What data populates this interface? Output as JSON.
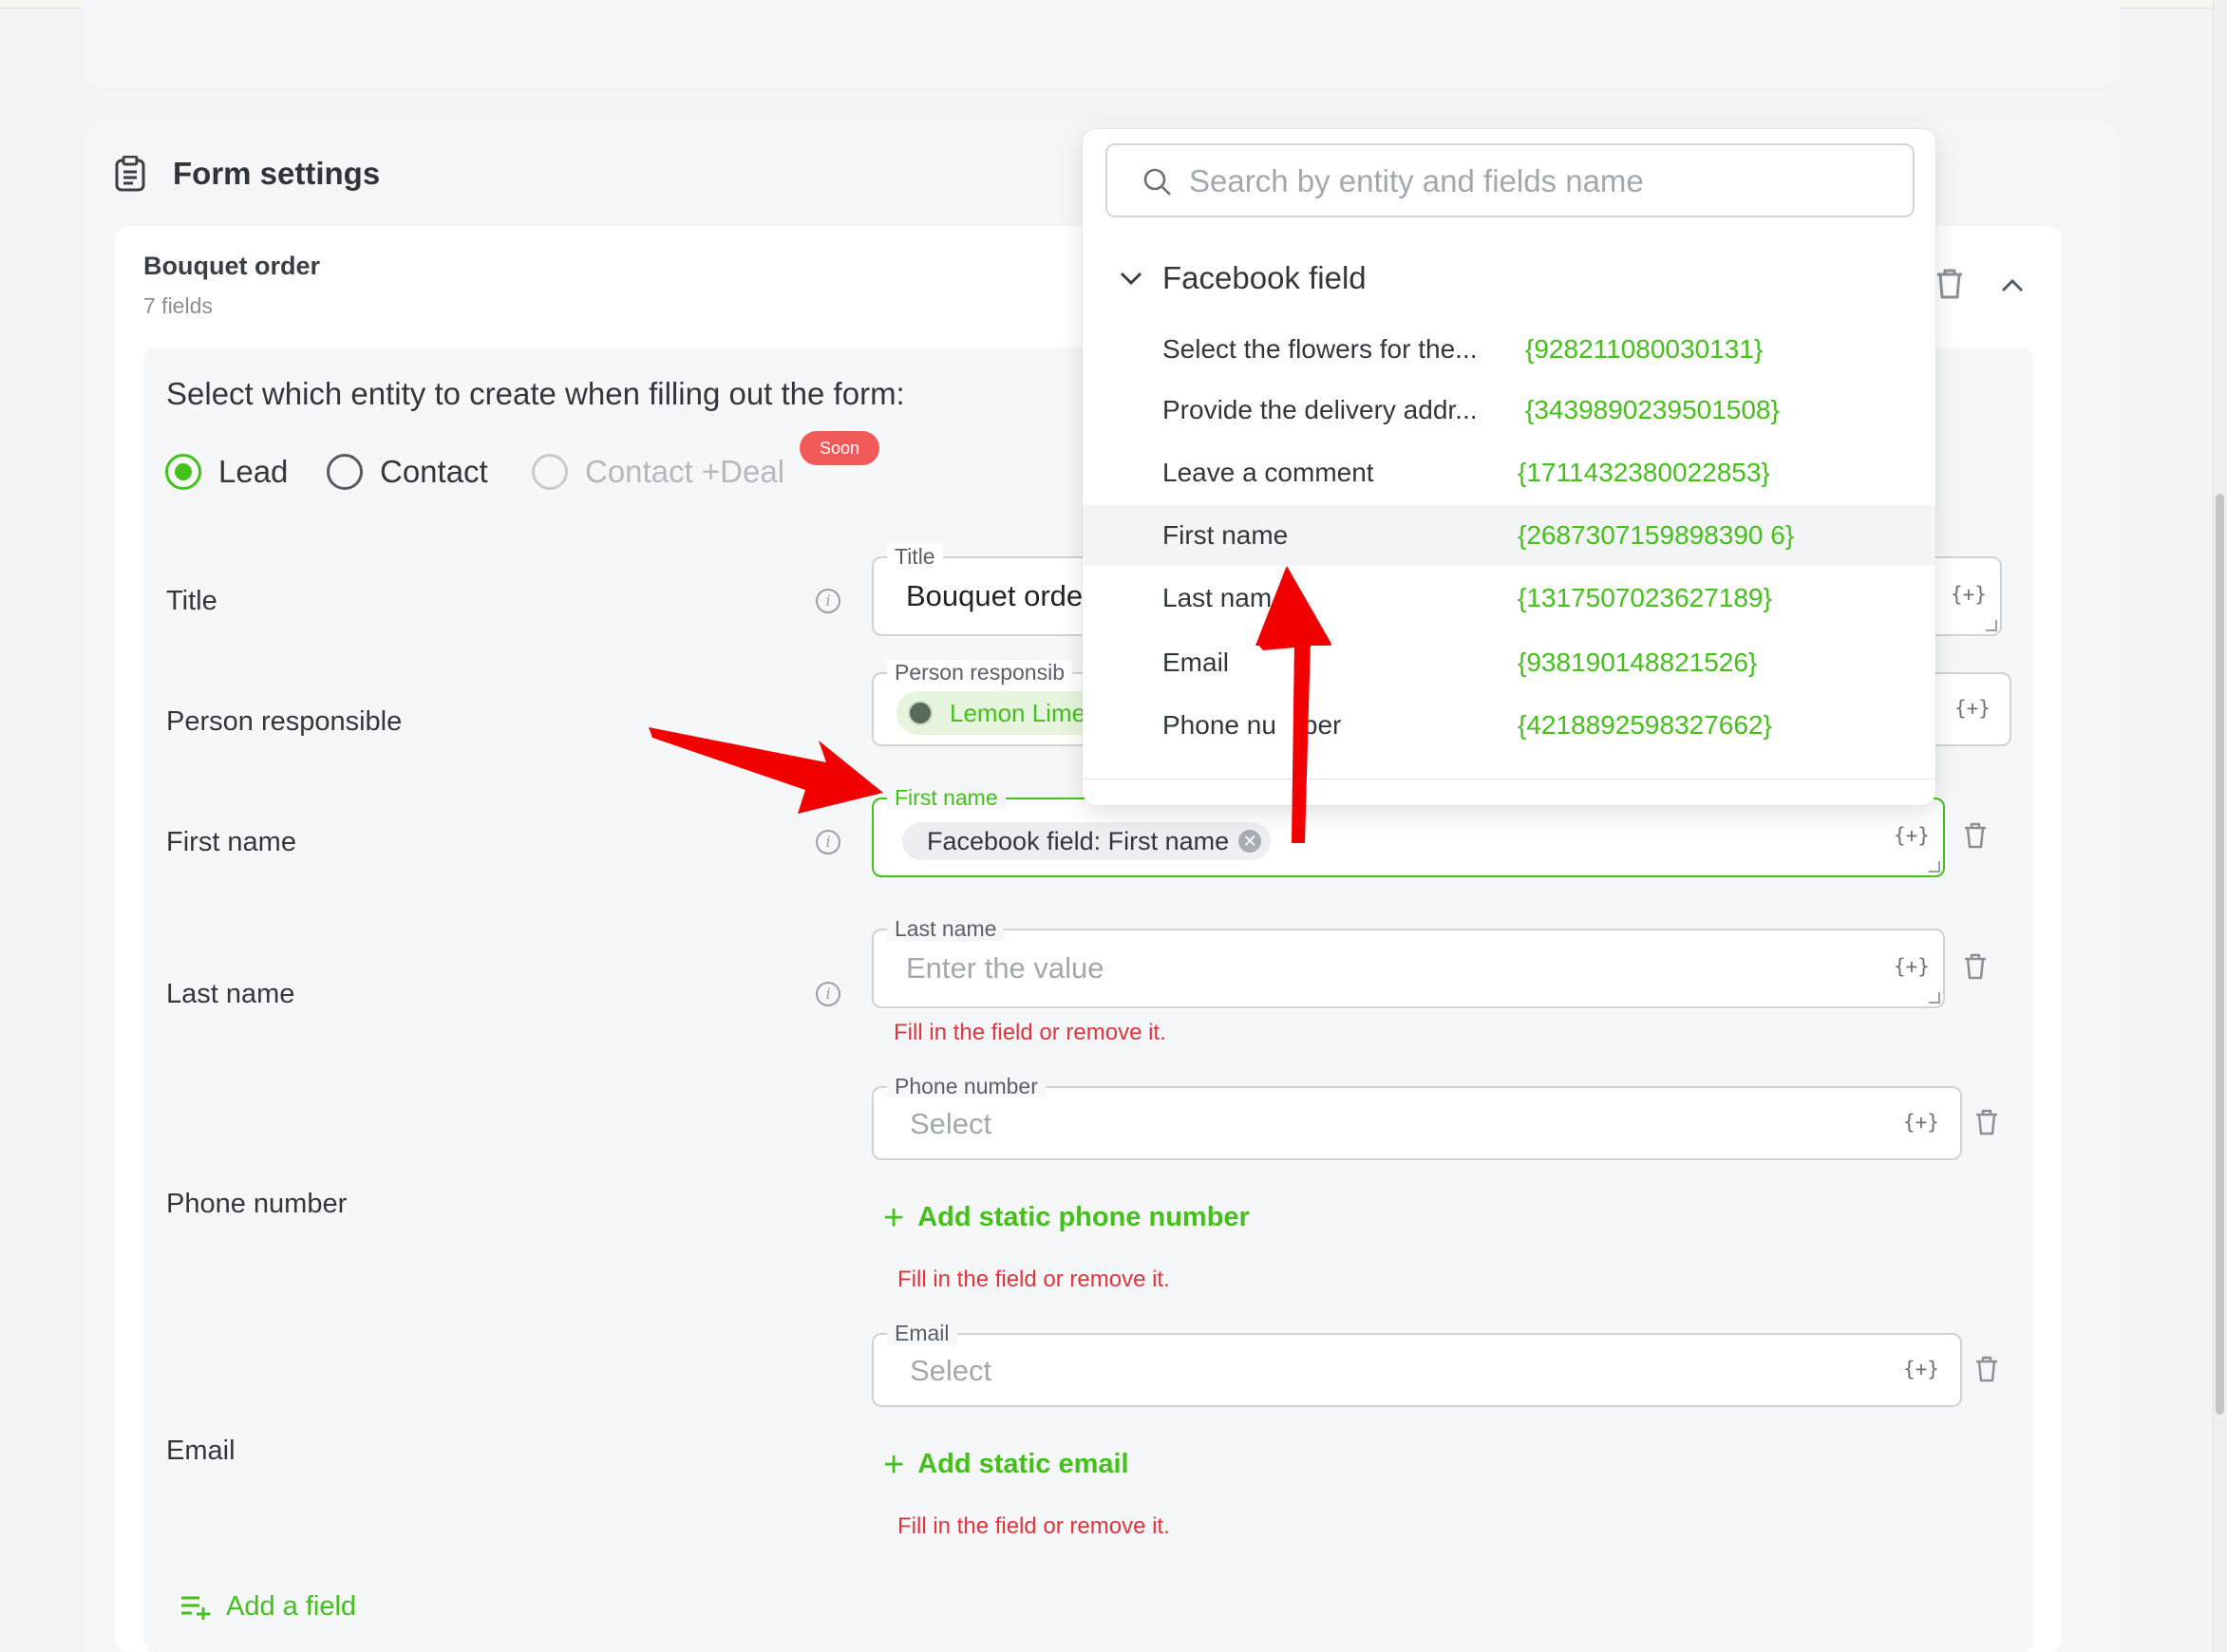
{
  "section": {
    "title": "Form settings"
  },
  "form": {
    "name": "Bouquet order",
    "count": "7 fields"
  },
  "entity": {
    "prompt": "Select which entity to create when filling out the form:",
    "options": [
      {
        "label": "Lead",
        "selected": true
      },
      {
        "label": "Contact",
        "selected": false
      },
      {
        "label": "Contact +Deal",
        "disabled": true
      }
    ],
    "soon_badge": "Soon"
  },
  "fields": {
    "title": {
      "row_label": "Title",
      "legend": "Title",
      "value": "Bouquet orde",
      "var_button": "{+}"
    },
    "person": {
      "row_label": "Person responsible",
      "legend": "Person responsib",
      "chip": "Lemon Lime",
      "var_button": "{+}"
    },
    "first_name": {
      "row_label": "First name",
      "legend": "First name",
      "chip": "Facebook field: First name",
      "chip_remove": "✕",
      "var_button": "{+}"
    },
    "last_name": {
      "row_label": "Last name",
      "legend": "Last name",
      "placeholder": "Enter the value",
      "var_button": "{+}",
      "error": "Fill in the field or remove it."
    },
    "phone": {
      "row_label": "Phone number",
      "legend": "Phone number",
      "placeholder": "Select",
      "var_button": "{+}",
      "add_static": "Add static phone number",
      "error": "Fill in the field or remove it."
    },
    "email": {
      "row_label": "Email",
      "legend": "Email",
      "placeholder": "Select",
      "var_button": "{+}",
      "add_static": "Add static email",
      "error": "Fill in the field or remove it."
    }
  },
  "add_field": "Add a field",
  "dropdown": {
    "search_placeholder": "Search by entity and fields name",
    "group": "Facebook field",
    "items": [
      {
        "name": "Select the flowers for the...",
        "id": "{928211080030131}"
      },
      {
        "name": "Provide the delivery addr...",
        "id": "{3439890239501508}"
      },
      {
        "name": "Leave a comment",
        "id": "{1711432380022853}"
      },
      {
        "name": "First name",
        "id": "{2687307159898390 6}"
      },
      {
        "name": "Last nam",
        "id": "{1317507023627189}"
      },
      {
        "name": "Email",
        "id": "{938190148821526}"
      },
      {
        "name": "Phone nu",
        "name_tail": "ber",
        "id": "{4218892598327662}"
      }
    ],
    "highlighted_index": 3
  },
  "colors": {
    "accent": "#44c01a",
    "error": "#e2343a",
    "badge": "#f25a5a",
    "annotation_arrow": "#ff0000"
  },
  "icons": [
    "clipboard-icon",
    "trash-icon",
    "chevron-up-icon",
    "chevron-down-icon",
    "search-icon",
    "info-icon",
    "add-field-icon"
  ]
}
